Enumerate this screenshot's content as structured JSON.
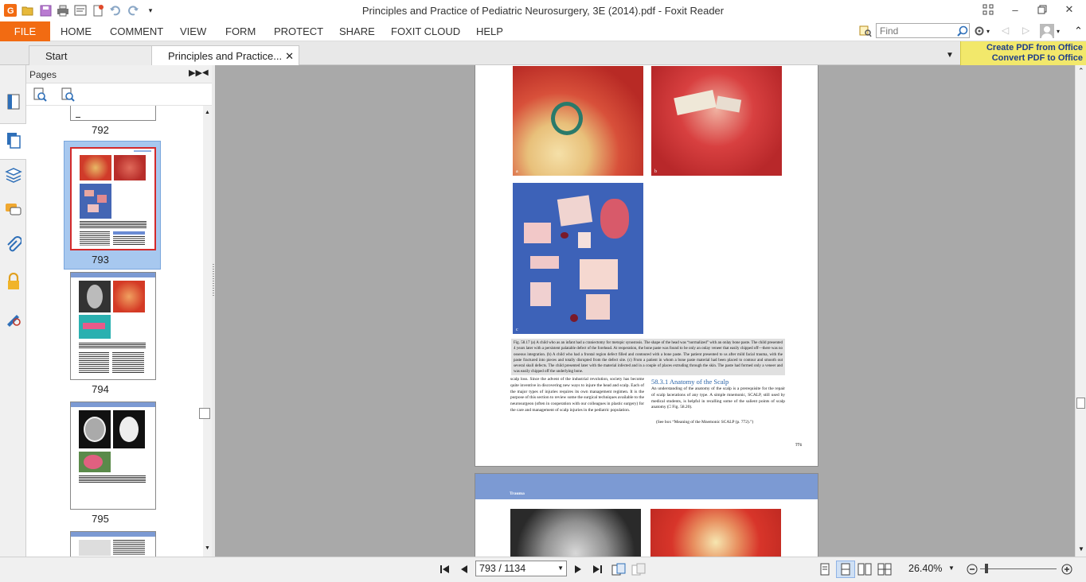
{
  "window": {
    "title": "Principles and Practice of Pediatric Neurosurgery, 3E (2014).pdf - Foxit Reader"
  },
  "ribbon": {
    "file": "FILE",
    "tabs": [
      "HOME",
      "COMMENT",
      "VIEW",
      "FORM",
      "PROTECT",
      "SHARE",
      "FOXIT CLOUD",
      "HELP"
    ],
    "find_placeholder": "Find"
  },
  "doc_tabs": {
    "start": "Start",
    "current": "Principles and Practice..."
  },
  "promo": {
    "line1": "Create PDF from Office",
    "line2": "Convert PDF to Office"
  },
  "pages_panel": {
    "title": "Pages",
    "thumbnails": [
      "792",
      "793",
      "794",
      "795"
    ],
    "selected": "793"
  },
  "page": {
    "labels": {
      "a": "a",
      "b": "b",
      "c": "c"
    },
    "caption": "Fig. 58.17 (a) A child who as an infant had a craniectomy for metopic synostosis. The shape of the head was “normalized” with an onlay bone paste. The child presented 4 years later with a persistent palatable defect of the forehead. At reoperation, the bone paste was found to be only an onlay veneer that easily chipped off—there was no osseous integration. (b) A child who had a frontal region defect filled and contoured with a bone paste. The patient presented to us after mild facial trauma, with the paste fractured into pieces and totally disrupted from the defect site. (c) From a patient in whom a bone paste material had been placed to contour and smooth out several skull defects. The child presented later with the material infected and in a couple of places extruding through the skin. The paste had formed only a veneer and was easily chipped off the underlying bone.",
    "left_col": "scalp loss. Since the advent of the industrial revolution, society has become quite inventive in discovering new ways to injure the head and scalp. Each of the major types of injuries requires its own management regimen. It is the purpose of this section to review some the surgical techniques available to the neurosurgeon (often in cooperation with our colleagues in plastic surgery) for the care and management of scalp injuries in the pediatric population.",
    "section_heading": "58.3.1  Anatomy of the Scalp",
    "right_col": "An understanding of the anatomy of the scalp is a prerequisite for the repair of scalp lacerations of any type. A simple mnemonic, SCALP, still used by medical students, is helpful in recalling some of the salient points of scalp anatomy (□ Fig. 58.20).",
    "see_box": "(See box “Meaning of the Mnemonic SCALP (p. 772).”)",
    "page_number": "771",
    "next_header": "Trauma"
  },
  "status": {
    "page_field": "793 / 1134",
    "zoom": "26.40%",
    "zoom_fraction": 0.08
  },
  "colors": {
    "file_tab": "#f26b12",
    "selection": "#a7c8ef",
    "next_page_header": "#7c9ad3",
    "doc_bg": "#a9a9a9"
  }
}
